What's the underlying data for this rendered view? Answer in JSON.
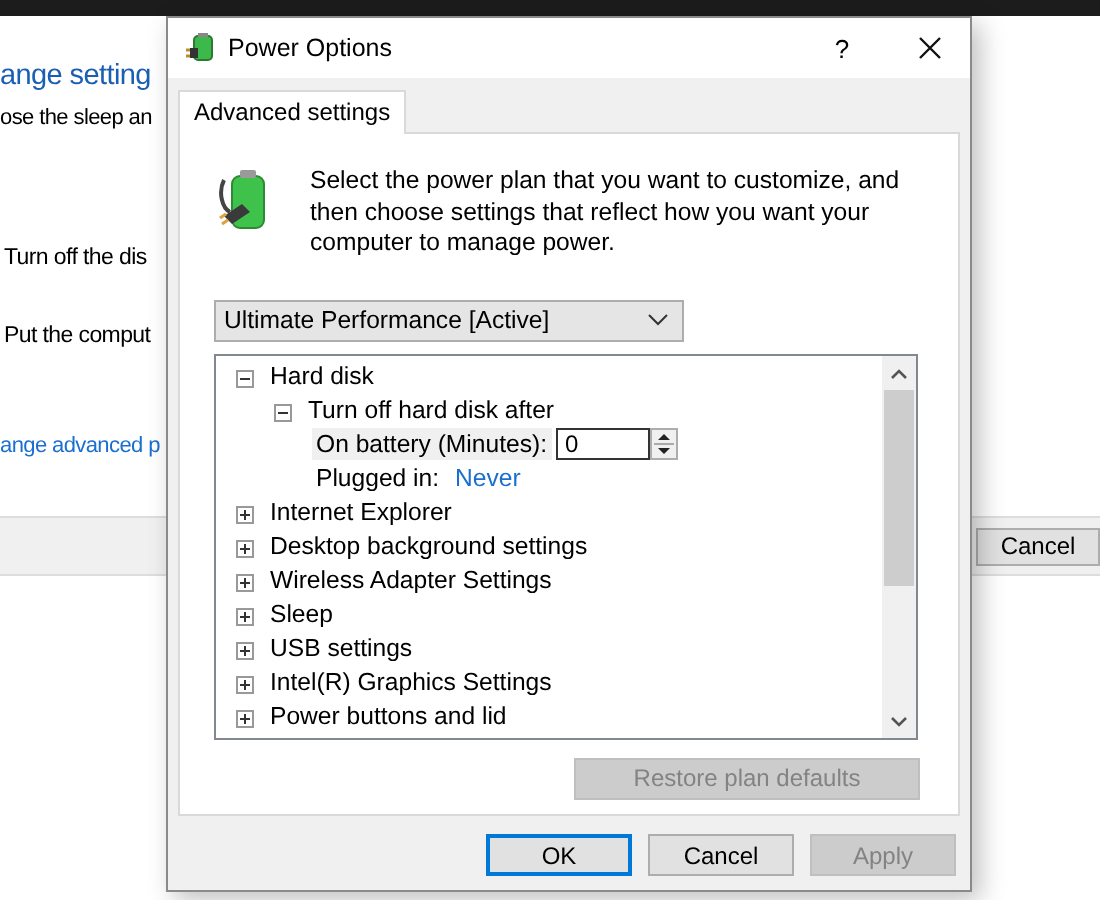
{
  "background_window": {
    "heading": "ange setting",
    "subtitle": "ose the sleep an",
    "options": [
      "Turn off the dis",
      "Put the comput"
    ],
    "link": "ange advanced p",
    "cancel_button": "Cancel"
  },
  "dialog": {
    "title": "Power Options",
    "help_button": "?",
    "tabs": [
      {
        "label": "Advanced settings",
        "selected": true
      }
    ],
    "description": "Select the power plan that you want to customize, and then choose settings that reflect how you want your computer to manage power.",
    "plan_dropdown": {
      "value": "Ultimate Performance [Active]"
    },
    "tree": [
      {
        "label": "Hard disk",
        "expanded": true,
        "children": [
          {
            "label": "Turn off hard disk after",
            "expanded": true,
            "children": [
              {
                "kind": "spin",
                "label": "On battery (Minutes):",
                "value": "0",
                "selected": true
              },
              {
                "kind": "link",
                "label": "Plugged in:",
                "value": "Never",
                "selected": false
              }
            ]
          }
        ]
      },
      {
        "label": "Internet Explorer",
        "expanded": false
      },
      {
        "label": "Desktop background settings",
        "expanded": false
      },
      {
        "label": "Wireless Adapter Settings",
        "expanded": false
      },
      {
        "label": "Sleep",
        "expanded": false
      },
      {
        "label": "USB settings",
        "expanded": false
      },
      {
        "label": "Intel(R) Graphics Settings",
        "expanded": false
      },
      {
        "label": "Power buttons and lid",
        "expanded": false
      }
    ],
    "restore_button": {
      "label": "Restore plan defaults",
      "disabled": true
    },
    "buttons": [
      {
        "label": "OK",
        "default": true,
        "disabled": false
      },
      {
        "label": "Cancel",
        "default": false,
        "disabled": false
      },
      {
        "label": "Apply",
        "default": false,
        "disabled": true
      }
    ]
  }
}
